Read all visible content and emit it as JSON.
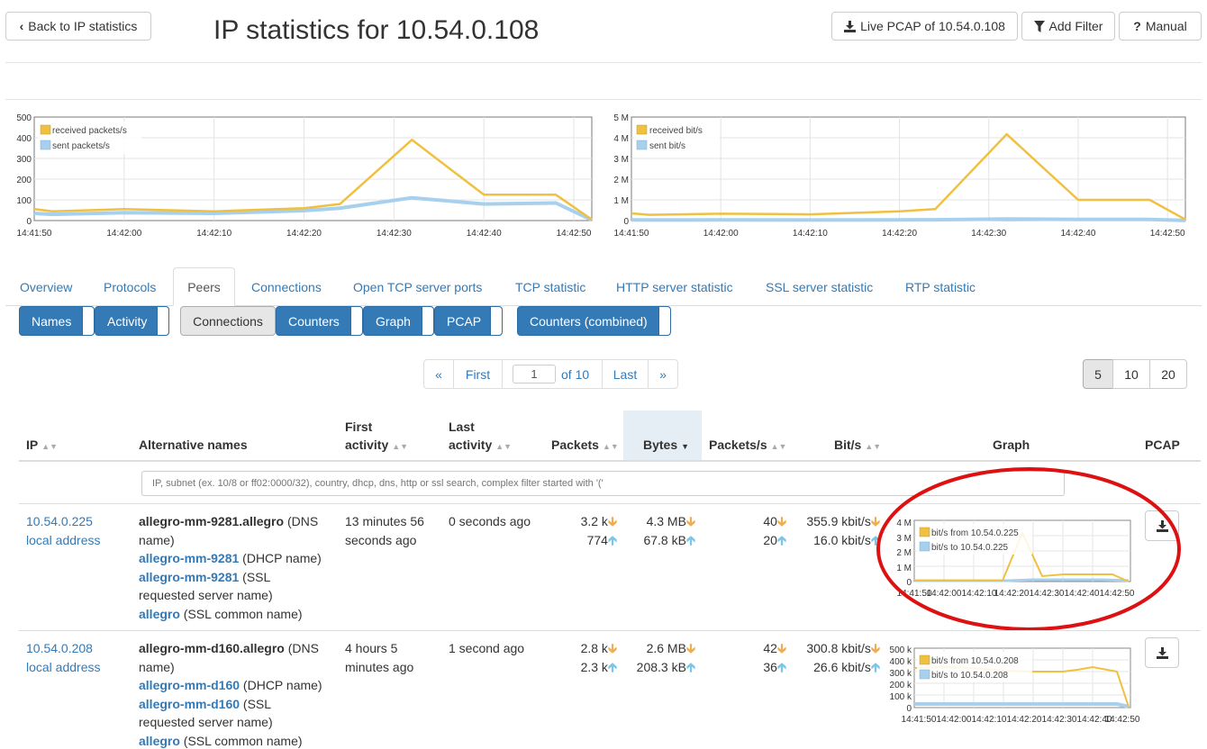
{
  "header": {
    "back_label": "Back to IP statistics",
    "title": "IP statistics for 10.54.0.108",
    "live_pcap_label": "Live PCAP of 10.54.0.108",
    "add_filter_label": "Add Filter",
    "manual_label": "Manual"
  },
  "charts": {
    "packets": {
      "legend": [
        "received packets/s",
        "sent packets/s"
      ],
      "y_ticks": [
        "500",
        "400",
        "300",
        "200",
        "100",
        "0"
      ],
      "x_ticks": [
        "14:41:50",
        "14:42:00",
        "14:42:10",
        "14:42:20",
        "14:42:30",
        "14:42:40",
        "14:42:50"
      ]
    },
    "bits": {
      "legend": [
        "received bit/s",
        "sent bit/s"
      ],
      "y_ticks": [
        "5 M",
        "4 M",
        "3 M",
        "2 M",
        "1 M",
        "0"
      ],
      "x_ticks": [
        "14:41:50",
        "14:42:00",
        "14:42:10",
        "14:42:20",
        "14:42:30",
        "14:42:40",
        "14:42:50"
      ]
    }
  },
  "chart_data": [
    {
      "type": "line",
      "x": [
        "14:41:50",
        "14:41:52",
        "14:42:00",
        "14:42:10",
        "14:42:20",
        "14:42:24",
        "14:42:32",
        "14:42:40",
        "14:42:48",
        "14:42:52"
      ],
      "series": [
        {
          "name": "received packets/s",
          "values": [
            55,
            45,
            55,
            45,
            60,
            80,
            390,
            125,
            125,
            5
          ]
        },
        {
          "name": "sent packets/s",
          "values": [
            35,
            30,
            38,
            35,
            48,
            60,
            110,
            80,
            85,
            3
          ]
        }
      ],
      "ylim": [
        0,
        500
      ],
      "grid": true,
      "legend": "top-left"
    },
    {
      "type": "line",
      "x": [
        "14:41:50",
        "14:41:52",
        "14:42:00",
        "14:42:10",
        "14:42:20",
        "14:42:24",
        "14:42:32",
        "14:42:40",
        "14:42:48",
        "14:42:52"
      ],
      "series": [
        {
          "name": "received bit/s",
          "values": [
            350000,
            280000,
            330000,
            300000,
            450000,
            550000,
            4170000,
            1000000,
            1000000,
            50000
          ]
        },
        {
          "name": "sent bit/s",
          "values": [
            30000,
            25000,
            30000,
            28000,
            35000,
            40000,
            80000,
            50000,
            50000,
            5000
          ]
        }
      ],
      "ylim": [
        0,
        5000000
      ],
      "grid": true,
      "legend": "top-left"
    }
  ],
  "tabs": [
    "Overview",
    "Protocols",
    "Peers",
    "Connections",
    "Open TCP server ports",
    "TCP statistic",
    "HTTP server statistic",
    "SSL server statistic",
    "RTP statistic"
  ],
  "subtabs": [
    "Names",
    "Activity",
    "Connections",
    "Counters",
    "Graph",
    "PCAP",
    "Counters (combined)"
  ],
  "pagination": {
    "prev": "«",
    "first": "First",
    "page": "1",
    "of": "of 10",
    "last": "Last",
    "next": "»"
  },
  "page_sizes": [
    "5",
    "10",
    "20"
  ],
  "table": {
    "headers": {
      "ip": "IP",
      "alt_names": "Alternative names",
      "first_activity_1": "First",
      "first_activity_2": "activity",
      "last_activity_1": "Last",
      "last_activity_2": "activity",
      "packets": "Packets",
      "bytes": "Bytes",
      "packets_s": "Packets/s",
      "bits_s": "Bit/s",
      "graph": "Graph",
      "pcap": "PCAP"
    },
    "filter_placeholder": "IP, subnet (ex. 10/8 or ff02:0000/32), country, dhcp, dns, http or ssl search, complex filter started with '('",
    "rows": [
      {
        "ip": "10.54.0.225",
        "ip_note": "local address",
        "names": [
          {
            "name": "allegro-mm-9281.allegro",
            "type": " (DNS"
          },
          {
            "type": "name)"
          },
          {
            "name": "allegro-mm-9281",
            "type": " (DHCP name)"
          },
          {
            "name": "allegro-mm-9281",
            "type": " (SSL"
          },
          {
            "type": "requested server name)"
          },
          {
            "name": "allegro",
            "type": " (SSL common name)"
          }
        ],
        "first_activity": [
          "13 minutes 56",
          "seconds ago"
        ],
        "last_activity": "0 seconds ago",
        "packets_in": "3.2 k",
        "packets_out": "774",
        "bytes_in": "4.3 MB",
        "bytes_out": "67.8 kB",
        "pps_in": "40",
        "pps_out": "20",
        "bits_in": "355.9 kbit/s",
        "bits_out": "16.0 kbit/s",
        "graph_legend": [
          "bit/s from 10.54.0.225",
          "bit/s to 10.54.0.225"
        ],
        "graph_y": [
          "4 M",
          "3 M",
          "2 M",
          "1 M",
          "0"
        ],
        "graph_x": [
          "14:41:50",
          "14:42:00",
          "14:42:10",
          "14:42:20",
          "14:42:30",
          "14:42:40",
          "14:42:50"
        ]
      },
      {
        "ip": "10.54.0.208",
        "ip_note": "local address",
        "names": [
          {
            "name": "allegro-mm-d160.allegro",
            "type": " (DNS"
          },
          {
            "type": "name)"
          },
          {
            "name": "allegro-mm-d160",
            "type": " (DHCP name)"
          },
          {
            "name": "allegro-mm-d160",
            "type": " (SSL"
          },
          {
            "type": "requested server name)"
          },
          {
            "name": "allegro",
            "type": " (SSL common name)"
          }
        ],
        "first_activity": [
          "4 hours 5",
          "minutes ago"
        ],
        "last_activity": "1 second ago",
        "packets_in": "2.8 k",
        "packets_out": "2.3 k",
        "bytes_in": "2.6 MB",
        "bytes_out": "208.3 kB",
        "pps_in": "42",
        "pps_out": "36",
        "bits_in": "300.8 kbit/s",
        "bits_out": "26.6 kbit/s",
        "graph_legend": [
          "bit/s from 10.54.0.208",
          "bit/s to 10.54.0.208"
        ],
        "graph_y": [
          "500 k",
          "400 k",
          "300 k",
          "200 k",
          "100 k",
          "0"
        ],
        "graph_x": [
          "14:41:50",
          "14:42:00",
          "14:42:10",
          "14:42:20",
          "14:42:30",
          "14:42:40",
          "14:42:50"
        ]
      }
    ]
  },
  "colors": {
    "received": "#f0c040",
    "sent": "#a6d0ee",
    "link": "#337ab7",
    "primary": "#337ab7",
    "annotation": "#dd1111"
  }
}
